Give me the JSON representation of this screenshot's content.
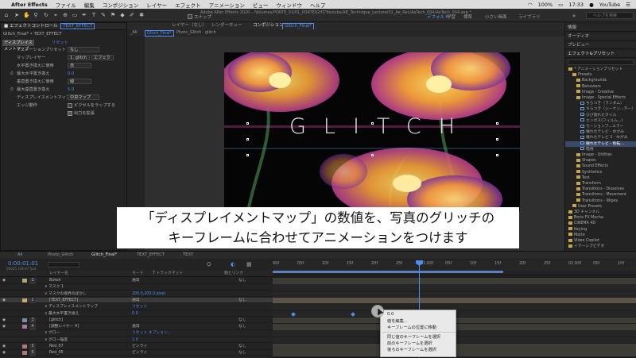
{
  "menubar": {
    "app": "After Effects",
    "items": [
      "ファイル",
      "編集",
      "コンポジション",
      "レイヤー",
      "エフェクト",
      "アニメーション",
      "ビュー",
      "ウィンドウ",
      "ヘルプ"
    ],
    "battery": "100%",
    "time": "17:33",
    "account": "YouTube"
  },
  "toolbar": {
    "snap_label": "スナップ",
    "title": "Adobe After Effects 2020 - /Volumes/PORT8_01/01_PORTEIGHT/Youtube/AE_Technique_Lecture/01_Ae_Rec/AeTech_004/AeTech_004.aep *",
    "workspaces": [
      "デフォルト",
      "学習",
      "標準",
      "小さい画面",
      "ライブラリ"
    ],
    "active_workspace": "デフォルト",
    "search_placeholder": "ヘルプを検索"
  },
  "effect_panel": {
    "tab_label": "エフェクトコントロール",
    "tab_selected": "TEXT_EFFECT",
    "breadcrumb": "Glitch_Final* • TEXT_EFFECT",
    "effect_name": "ディスプレイスメントマップ",
    "reset": "リセット",
    "rows": [
      {
        "label": "アニメーションプリセット",
        "value": "なし"
      },
      {
        "label": "マップレイヤー",
        "value": "1. glitch",
        "value2": "エフェク"
      },
      {
        "label": "水平置き換えに使用",
        "value": "赤"
      },
      {
        "label": "最大水平置き換え",
        "value": "0.0"
      },
      {
        "label": "垂直置き換えに使用",
        "value": "緑"
      },
      {
        "label": "最大垂直置き換え",
        "value": "5.0"
      },
      {
        "label": "ディスプレイスメントマップ",
        "value": "中央マップ"
      },
      {
        "label": "エッジ動作",
        "value": "ピクセルをラップする"
      },
      {
        "label": "",
        "value": "出力を拡張"
      }
    ]
  },
  "comp_panel": {
    "tabs": [
      "レイヤー（なし）",
      "レンダーキュー",
      "コンポジション",
      "Glitch_Final*"
    ],
    "sub_tabs": [
      "_All",
      "Glitch_Final*",
      "Photo_Glitch",
      "glitch"
    ],
    "composition_text": "GLITCH"
  },
  "subtitle": {
    "line1": "「ディスプレイメントマップ」の数値を、写真のグリッチの",
    "line2": "キーフレームに合わせてアニメーションをつけます"
  },
  "right_panel": {
    "headers": [
      "情報",
      "オーディオ",
      "プレビュー",
      "エフェクト&プリセット"
    ],
    "tree": [
      {
        "label": "* アニメーションプリセット",
        "indent": 0,
        "type": "folder"
      },
      {
        "label": "Presets",
        "indent": 1,
        "type": "folder"
      },
      {
        "label": "Backgrounds",
        "indent": 2,
        "type": "folder"
      },
      {
        "label": "Behaviors",
        "indent": 2,
        "type": "folder"
      },
      {
        "label": "Image - Creative",
        "indent": 2,
        "type": "folder"
      },
      {
        "label": "Image - Special Effects",
        "indent": 2,
        "type": "folder"
      },
      {
        "label": "ちらつき（ランダム）",
        "indent": 3,
        "type": "effect"
      },
      {
        "label": "ちらつき（シーケン...ター）",
        "indent": 3,
        "type": "effect"
      },
      {
        "label": "ひび割れたタイル",
        "indent": 3,
        "type": "effect"
      },
      {
        "label": "エンボス(フィルム...)",
        "indent": 3,
        "type": "effect"
      },
      {
        "label": "モーションブ...エラー",
        "indent": 3,
        "type": "effect"
      },
      {
        "label": "壊れたテレビ - ゆがみ",
        "indent": 3,
        "type": "effect"
      },
      {
        "label": "壊れたテレビ 2 - ゆがみ",
        "indent": 3,
        "type": "effect"
      },
      {
        "label": "壊れたテレビ - 色転...",
        "indent": 3,
        "type": "effect",
        "highlight": true
      },
      {
        "label": "暗視",
        "indent": 3,
        "type": "effect"
      },
      {
        "label": "Image - Utilities",
        "indent": 2,
        "type": "folder"
      },
      {
        "label": "Shapes",
        "indent": 2,
        "type": "folder"
      },
      {
        "label": "Sound Effects",
        "indent": 2,
        "type": "folder"
      },
      {
        "label": "Synthetics",
        "indent": 2,
        "type": "folder"
      },
      {
        "label": "Text",
        "indent": 2,
        "type": "folder"
      },
      {
        "label": "Transform",
        "indent": 2,
        "type": "folder"
      },
      {
        "label": "Transitions - Dissolves",
        "indent": 2,
        "type": "folder"
      },
      {
        "label": "Transitions - Movement",
        "indent": 2,
        "type": "folder"
      },
      {
        "label": "Transitions - Wipes",
        "indent": 2,
        "type": "folder"
      },
      {
        "label": "User Presets",
        "indent": 1,
        "type": "folder"
      },
      {
        "label": "3D チャンネル",
        "indent": 0,
        "type": "folder"
      },
      {
        "label": "Boris FX Mocha",
        "indent": 0,
        "type": "folder"
      },
      {
        "label": "CINEMA 4D",
        "indent": 0,
        "type": "folder"
      },
      {
        "label": "Keying",
        "indent": 0,
        "type": "folder"
      },
      {
        "label": "Matte",
        "indent": 0,
        "type": "folder"
      },
      {
        "label": "Video Copilot",
        "indent": 0,
        "type": "folder"
      },
      {
        "label": "イマーシブビデオ",
        "indent": 0,
        "type": "folder"
      }
    ]
  },
  "timeline": {
    "tabs": [
      "All",
      "Photo_Glitch",
      "Glitch_Final*",
      "TEXT_EFFECT",
      "TEXT"
    ],
    "timecode": "0:00:01:01",
    "fps_label": "00031 (29.97 fps)",
    "columns": {
      "name": "レイヤー名",
      "mode": "モード",
      "trkmat": "T トラックマット",
      "switches": "親とリンク"
    },
    "ruler_labels": [
      "00f",
      "05f",
      "10f",
      "15f",
      "20f",
      "25f",
      "01:00f",
      "05f",
      "10f",
      "15f",
      "20f",
      "25f",
      "02:00f",
      "05f",
      "10f"
    ],
    "layers": [
      {
        "num": "1",
        "name": "Bokeh",
        "mode": "通常",
        "parent": "なし",
        "color": "#b0a47a"
      },
      {
        "num": "",
        "name": "マスク 1",
        "mode": "",
        "parent": "",
        "color": ""
      },
      {
        "num": "",
        "name": "マスクの境界のぼかし",
        "mode": "",
        "parent": "",
        "color": "",
        "value": "200.0,200.0 pixel"
      },
      {
        "num": "2",
        "name": "[TEXT_EFFECT]",
        "mode": "通常",
        "parent": "なし",
        "color": "#c4a96b",
        "selected": true
      },
      {
        "num": "",
        "name": "ディスプレイスメントマップ",
        "mode": "",
        "parent": "",
        "color": "",
        "value": "リセット"
      },
      {
        "num": "",
        "name": "最大水平置き換え",
        "mode": "",
        "parent": "",
        "color": "",
        "value": "0.0"
      },
      {
        "num": "3",
        "name": "[glitch]",
        "mode": "",
        "parent": "なし",
        "color": "#7a8ea8"
      },
      {
        "num": "4",
        "name": "[調整レイヤー 4]",
        "mode": "通常",
        "parent": "なし",
        "color": "#a87a9a"
      },
      {
        "num": "",
        "name": "グロー",
        "mode": "",
        "parent": "",
        "color": "",
        "value": "リセット オプション..."
      },
      {
        "num": "",
        "name": "グロー強度",
        "mode": "",
        "parent": "",
        "color": "",
        "value": "1.0"
      },
      {
        "num": "5",
        "name": "Red_07",
        "mode": "ピンライ",
        "parent": "なし",
        "color": "#a87a7a"
      },
      {
        "num": "6",
        "name": "Red_05",
        "mode": "ピンライ",
        "parent": "なし",
        "color": "#a87a7a"
      }
    ],
    "keyframe_times_s": [
      0.13,
      0.53,
      0.87,
      1.03
    ]
  },
  "context_menu": {
    "items": [
      "0.0",
      "値を編集...",
      "キーフレームの位置に移動",
      "同じ値のキーフレームを選択",
      "前のキーフレームを選択",
      "後ろのキーフレームを選択"
    ]
  }
}
